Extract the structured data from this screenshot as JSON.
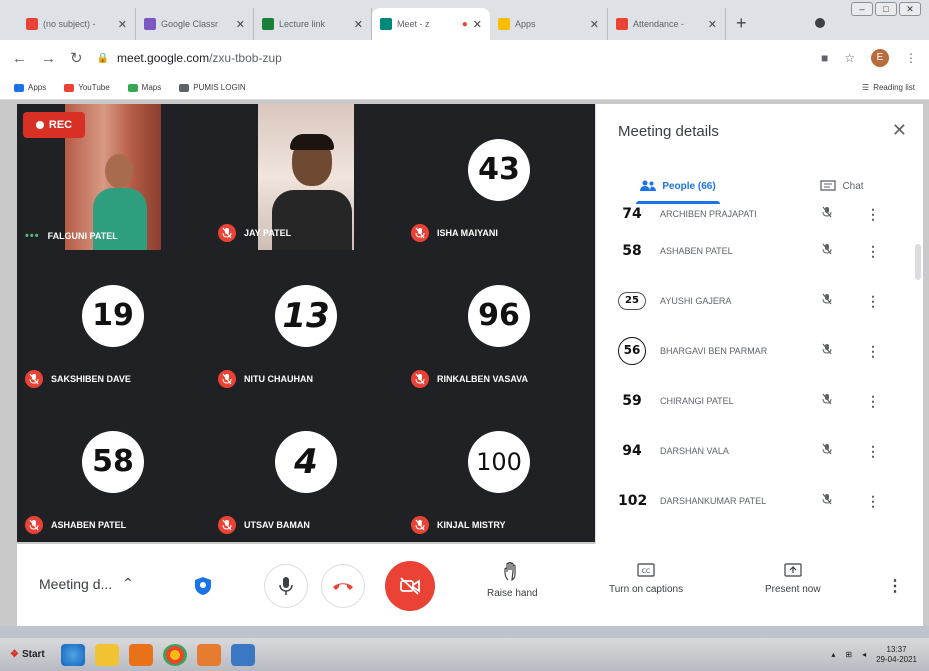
{
  "browser": {
    "tabs": [
      {
        "label": "(no subject) -",
        "favicon_color": "#ea4335",
        "favicon_text": "M"
      },
      {
        "label": "Google Classr",
        "favicon_color": "#7e57c2",
        "favicon_text": ""
      },
      {
        "label": "Lecture link",
        "favicon_color": "#188038",
        "favicon_text": ""
      },
      {
        "label": "Meet - z",
        "favicon_color": "#00897b",
        "favicon_text": "",
        "active": true
      },
      {
        "label": "Apps",
        "favicon_color": "#fbbc04",
        "favicon_text": ""
      },
      {
        "label": "Attendance -",
        "favicon_color": "#ea4335",
        "favicon_text": ""
      }
    ],
    "url_host": "meet.google.com",
    "url_path": "/zxu-tbob-zup",
    "bookmarks": [
      {
        "label": "Apps",
        "color": "#1a73e8"
      },
      {
        "label": "YouTube",
        "color": "#ea4335"
      },
      {
        "label": "Maps",
        "color": "#34a853"
      },
      {
        "label": "PUMIS LOGIN",
        "color": "#5f6368"
      }
    ],
    "reading_list": "Reading list",
    "avatar_letter": "E"
  },
  "meet": {
    "rec_label": "REC",
    "tiles": [
      {
        "name": "FALGUNI PATEL",
        "type": "video-woman",
        "muted": false
      },
      {
        "name": "JAY PATEL",
        "type": "video-man",
        "muted": true
      },
      {
        "name": "ISHA MAIYANI",
        "type": "badge",
        "badge": "43",
        "muted": true
      },
      {
        "name": "SAKSHIBEN DAVE",
        "type": "badge",
        "badge": "19",
        "muted": true
      },
      {
        "name": "NITU CHAUHAN",
        "type": "badge",
        "badge": "13",
        "muted": true
      },
      {
        "name": "RINKALBEN VASAVA",
        "type": "badge",
        "badge": "96",
        "muted": true
      },
      {
        "name": "ASHABEN PATEL",
        "type": "badge",
        "badge": "58",
        "muted": true
      },
      {
        "name": "UTSAV BAMAN",
        "type": "badge",
        "badge": "4",
        "muted": true
      },
      {
        "name": "KINJAL MISTRY",
        "type": "badge",
        "badge": "100",
        "muted": true
      }
    ]
  },
  "panel": {
    "title": "Meeting details",
    "tab_people": "People (66)",
    "tab_chat": "Chat",
    "people": [
      {
        "badge": "74",
        "name": "ARCHIBEN PRAJAPATI"
      },
      {
        "badge": "58",
        "name": "ASHABEN PATEL"
      },
      {
        "badge": "25",
        "name": "AYUSHI GAJERA"
      },
      {
        "badge": "56",
        "name": "BHARGAVI BEN PARMAR"
      },
      {
        "badge": "59",
        "name": "CHIRANGI PATEL"
      },
      {
        "badge": "94",
        "name": "DARSHAN VALA"
      },
      {
        "badge": "102",
        "name": "DARSHANKUMAR PATEL"
      }
    ]
  },
  "controls": {
    "meeting_details": "Meeting d...",
    "raise_hand": "Raise hand",
    "captions": "Turn on captions",
    "present": "Present now"
  },
  "taskbar": {
    "start": "Start",
    "time": "13:37",
    "date": "29-04-2021"
  }
}
